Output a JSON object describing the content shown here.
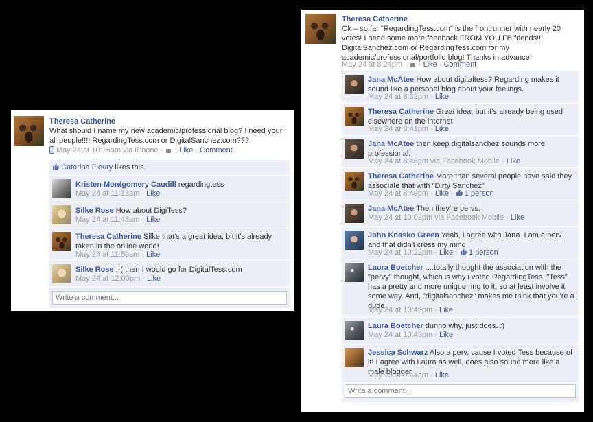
{
  "left_post": {
    "author": "Theresa Catherine",
    "text": "What should I name my new academic/professional blog? I need your all people!!!! RegardingTess.com or DigitalSanchez.com???",
    "timestamp": "May 24 at 10:16am via iPhone",
    "sep": " · ",
    "like_label": "Like",
    "comment_label": "Comment",
    "likes_by": "Catarina Fleury",
    "likes_suffix": " likes this.",
    "comments": [
      {
        "author": "Kristen Montgomery Caudill",
        "text": " regardingtess",
        "time": "May 24 at 11:13am",
        "like": "Like"
      },
      {
        "author": "Silke Rose",
        "text": " How about DigiTess?",
        "time": "May 24 at 11:48am",
        "like": "Like"
      },
      {
        "author": "Theresa Catherine",
        "text": " Silke that's a great idea, bit it's already taken in the online world!",
        "time": "May 24 at 11:50am",
        "like": "Like"
      },
      {
        "author": "Silke Rose",
        "text": " :-( then I would go for DigitalTess.com",
        "time": "May 24 at 12:00pm",
        "like": "Like"
      }
    ],
    "write_placeholder": "Write a comment..."
  },
  "right_post": {
    "author": "Theresa Catherine",
    "text": "Ok – so far \"RegardingTess.com\" is the frontrunner with nearly 20 votes! I need some more feedback FROM YOU FB friends!!! DigitalSanchez.com or RegardingTess.com for my academic/professional/portfolio blog! Thanks in advance!",
    "timestamp": "May 24 at 8:24pm",
    "sep": " · ",
    "like_label": "Like",
    "comment_label": "Comment",
    "comments": [
      {
        "author": "Jana McAtee",
        "text": " How about digitaltess? Regarding makes it sound like a personal blog about your feelings.",
        "time": "May 24 at 8:32pm",
        "like": "Like",
        "extra": ""
      },
      {
        "author": "Theresa Catherine",
        "text": " Great idea, but it's already being used elsewhere on the internet",
        "time": "May 24 at 8:41pm",
        "like": "Like",
        "extra": ""
      },
      {
        "author": "Jana McAtee",
        "text": " then keep digitalsanchez sounds more professional.",
        "time": "May 24 at 8:46pm via Facebook Mobile",
        "like": "Like",
        "extra": ""
      },
      {
        "author": "Theresa Catherine",
        "text": " More than several people have said they associate that with \"Dirty Sanchez\"",
        "time": "May 24 at 8:49pm",
        "like": "Like",
        "extra": "1 person"
      },
      {
        "author": "Jana McAtee",
        "text": " Then they're pervs.",
        "time": "May 24 at 10:02pm via Facebook Mobile",
        "like": "Like",
        "extra": ""
      },
      {
        "author": "John Knasko Green",
        "text": " Yeah, I agree with Jana. I am a perv and that didn't cross my mind",
        "time": "May 24 at 10:22pm",
        "like": "Like",
        "extra": "1 person"
      },
      {
        "author": "Laura Boetcher",
        "text": " ....totally thought the association with the \"pervy\" thought, which is why i voted RegardingTess. \"Tess\" has a pretty and more unique ring to it, so at least involve it some way. And, \"digitalsanchez\" makes me think that you're a dude",
        "time": "May 24 at 10:49pm",
        "like": "Like",
        "extra": ""
      },
      {
        "author": "Laura Boetcher",
        "text": " dunno why, just does. :)",
        "time": "May 24 at 10:49pm",
        "like": "Like",
        "extra": ""
      },
      {
        "author": "Jessica Schwarz",
        "text": " Also a perv, cause I voted Tess because of it! I agree with Laura as well, does also sound more like a male blogger.",
        "time": "May 25 at 9:44am",
        "like": "Like",
        "extra": ""
      }
    ],
    "write_placeholder": "Write a comment..."
  },
  "colors": {
    "link": "#3b5998",
    "meta": "#999999",
    "thread_bg": "#eceff5",
    "page_bg": "#000000"
  }
}
